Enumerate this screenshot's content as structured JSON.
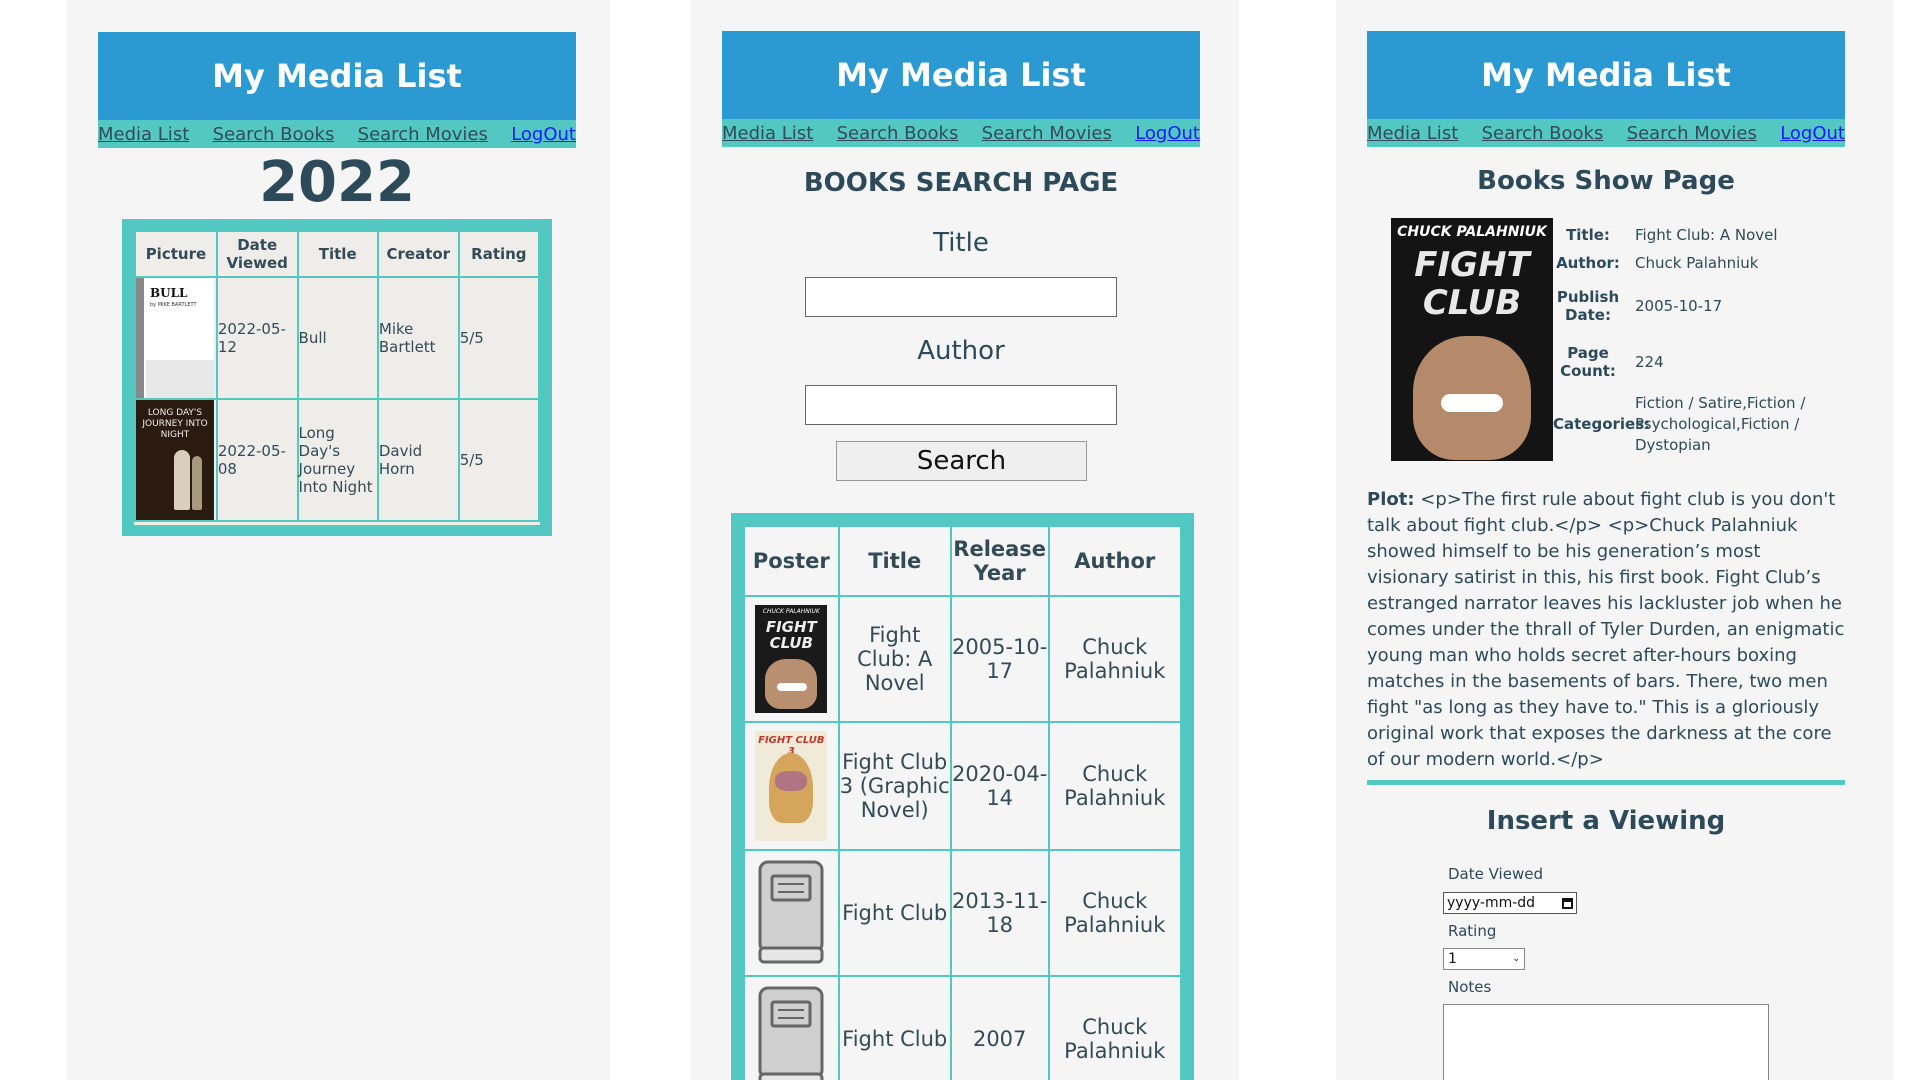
{
  "app_title": "My Media List",
  "nav": {
    "media_list": "Media List",
    "search_books": "Search Books",
    "search_movies": "Search Movies",
    "logout": "LogOut"
  },
  "list_page": {
    "year": "2022",
    "headers": [
      "Picture",
      "Date Viewed",
      "Title",
      "Creator",
      "Rating"
    ],
    "rows": [
      {
        "cover_title": "BULL",
        "cover_author": "by MIKE BARTLETT",
        "date": "2022-05-12",
        "title": "Bull",
        "creator": "Mike Bartlett",
        "rating": "5/5"
      },
      {
        "cover_title": "LONG DAY'S JOURNEY INTO NIGHT",
        "date": "2022-05-08",
        "title": "Long Day's Journey Into Night",
        "creator": "David Horn",
        "rating": "5/5"
      }
    ]
  },
  "search_page": {
    "heading": "BOOKS SEARCH PAGE",
    "title_label": "Title",
    "title_value": "",
    "author_label": "Author",
    "author_value": "",
    "search_button": "Search",
    "headers": [
      "Poster",
      "Title",
      "Release Year",
      "Author"
    ],
    "rows": [
      {
        "poster": "fight-club-cover",
        "cover_line1": "CHUCK PALAHNIUK",
        "cover_line2": "FIGHT CLUB",
        "title": "Fight Club: A Novel",
        "year": "2005-10-17",
        "author": "Chuck Palahniuk"
      },
      {
        "poster": "fight-club-3-cover",
        "cover_line1": "FIGHT CLUB 3",
        "title": "Fight Club 3 (Graphic Novel)",
        "year": "2020-04-14",
        "author": "Chuck Palahniuk"
      },
      {
        "poster": "placeholder-book-icon",
        "title": "Fight Club",
        "year": "2013-11-18",
        "author": "Chuck Palahniuk"
      },
      {
        "poster": "placeholder-book-icon",
        "title": "Fight Club",
        "year": "2007",
        "author": "Chuck Palahniuk"
      }
    ]
  },
  "show_page": {
    "heading": "Books Show Page",
    "cover_line1": "CHUCK PALAHNIUK",
    "cover_line2": "FIGHT CLUB",
    "fields": {
      "title_label": "Title:",
      "title": "Fight Club: A Novel",
      "author_label": "Author:",
      "author": "Chuck Palahniuk",
      "publish_label": "Publish Date:",
      "publish": "2005-10-17",
      "pages_label": "Page Count:",
      "pages": "224",
      "categories_label": "Categories:",
      "categories": "Fiction / Satire,Fiction / Psychological,Fiction / Dystopian"
    },
    "plot_label": "Plot:",
    "plot": " <p>The first rule about fight club is you don't talk about fight club.</p> <p>Chuck Palahniuk showed himself to be his generation’s most visionary satirist in this, his first book. Fight Club’s estranged narrator leaves his lackluster job when he comes under the thrall of Tyler Durden, an enigmatic young man who holds secret after-hours boxing matches in the basements of bars. There, two men fight \"as long as they have to.\" This is a gloriously original work that exposes the darkness at the core of our modern world.</p>",
    "insert_heading": "Insert a Viewing",
    "date_label": "Date Viewed",
    "date_placeholder": "yyyy-mm-dd",
    "rating_label": "Rating",
    "rating_value": "1",
    "notes_label": "Notes"
  },
  "colors": {
    "header_blue": "#2b9ad2",
    "teal": "#53c8c2",
    "text_dark": "#2c4a5a",
    "panel_bg": "#f5f5f5"
  }
}
